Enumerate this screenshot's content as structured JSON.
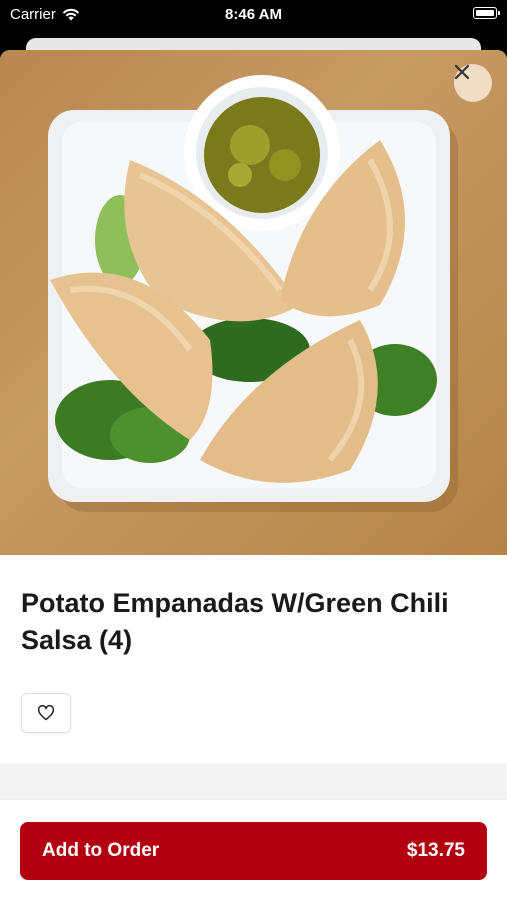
{
  "status_bar": {
    "carrier": "Carrier",
    "time": "8:46 AM"
  },
  "item": {
    "title": "Potato Empanadas W/Green Chili Salsa (4)",
    "price": "$13.75"
  },
  "actions": {
    "close_icon": "close-icon",
    "favorite_icon": "heart-icon",
    "add_to_order_label": "Add to Order"
  },
  "colors": {
    "brand": "#b3000f",
    "close_bg": "#f1dcc5"
  }
}
